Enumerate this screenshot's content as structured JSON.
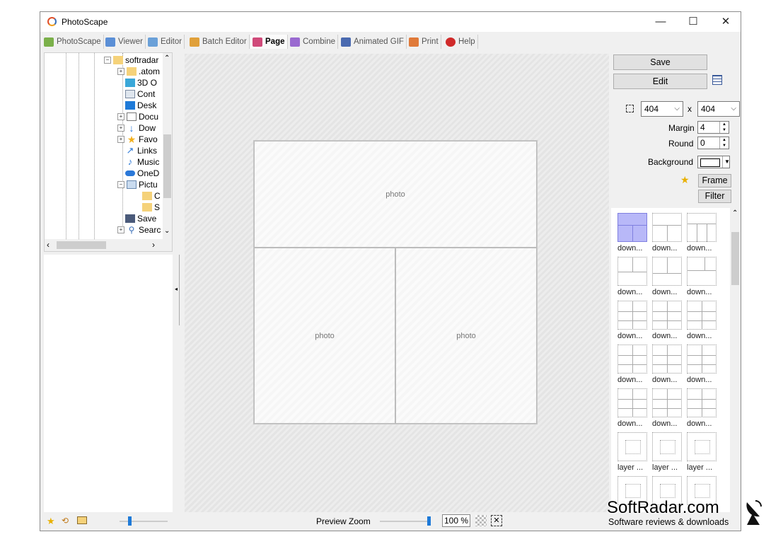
{
  "window": {
    "title": "PhotoScape",
    "minimize": "—",
    "maximize": "☐",
    "close": "✕"
  },
  "tabs": [
    {
      "label": "PhotoScape",
      "color": "#7bb04a",
      "icon": "photoscape-icon"
    },
    {
      "label": "Viewer",
      "color": "#5b8fd6",
      "icon": "viewer-icon"
    },
    {
      "label": "Editor",
      "color": "#6aa0d8",
      "icon": "editor-icon"
    },
    {
      "label": "Batch Editor",
      "color": "#e0a03a",
      "icon": "batch-editor-icon"
    },
    {
      "label": "Page",
      "color": "#d04a7a",
      "icon": "page-icon"
    },
    {
      "label": "Combine",
      "color": "#9a6ad0",
      "icon": "combine-icon"
    },
    {
      "label": "Animated GIF",
      "color": "#4a6ab0",
      "icon": "animated-gif-icon"
    },
    {
      "label": "Print",
      "color": "#e07a3a",
      "icon": "print-icon"
    },
    {
      "label": "Help",
      "color": "#d02a2a",
      "icon": "help-icon"
    }
  ],
  "tree": {
    "root": "softradar",
    "items": [
      {
        "label": ".atom",
        "icon": "folder",
        "expander": "+"
      },
      {
        "label": "3D O",
        "icon": "3d-objects",
        "expander": ""
      },
      {
        "label": "Cont",
        "icon": "contacts",
        "expander": ""
      },
      {
        "label": "Desk",
        "icon": "desktop",
        "expander": ""
      },
      {
        "label": "Docu",
        "icon": "documents",
        "expander": "+"
      },
      {
        "label": "Dow",
        "icon": "downloads",
        "expander": "+"
      },
      {
        "label": "Favo",
        "icon": "favorites",
        "expander": "+"
      },
      {
        "label": "Links",
        "icon": "links",
        "expander": ""
      },
      {
        "label": "Music",
        "icon": "music",
        "expander": ""
      },
      {
        "label": "OneD",
        "icon": "onedrive",
        "expander": ""
      },
      {
        "label": "Pictu",
        "icon": "pictures",
        "expander": "-"
      },
      {
        "label": "C",
        "icon": "folder",
        "expander": "",
        "child": true
      },
      {
        "label": "S",
        "icon": "folder",
        "expander": "",
        "child": true
      },
      {
        "label": "Save",
        "icon": "saved-games",
        "expander": ""
      },
      {
        "label": "Searc",
        "icon": "searches",
        "expander": "+"
      }
    ]
  },
  "canvas": {
    "cells": [
      "photo",
      "photo",
      "photo"
    ]
  },
  "panel": {
    "save": "Save",
    "edit": "Edit",
    "width": "404",
    "x": "x",
    "height": "404",
    "margin_label": "Margin",
    "margin_value": "4",
    "round_label": "Round",
    "round_value": "0",
    "background_label": "Background",
    "frame": "Frame",
    "filter": "Filter"
  },
  "templates": [
    {
      "name": "down...",
      "layout": "one-two",
      "selected": true
    },
    {
      "name": "down...",
      "layout": "one-two",
      "selected": false
    },
    {
      "name": "down...",
      "layout": "three-col",
      "selected": false
    },
    {
      "name": "down...",
      "layout": "top-left",
      "selected": false
    },
    {
      "name": "down...",
      "layout": "mid",
      "selected": false
    },
    {
      "name": "down...",
      "layout": "top-right",
      "selected": false
    },
    {
      "name": "down...",
      "layout": "grid",
      "selected": false
    },
    {
      "name": "down...",
      "layout": "grid",
      "selected": false
    },
    {
      "name": "down...",
      "layout": "grid",
      "selected": false
    },
    {
      "name": "down...",
      "layout": "grid",
      "selected": false
    },
    {
      "name": "down...",
      "layout": "grid",
      "selected": false
    },
    {
      "name": "down...",
      "layout": "grid",
      "selected": false
    },
    {
      "name": "down...",
      "layout": "grid",
      "selected": false
    },
    {
      "name": "down...",
      "layout": "grid",
      "selected": false
    },
    {
      "name": "down...",
      "layout": "grid",
      "selected": false
    },
    {
      "name": "layer ...",
      "layout": "layer",
      "selected": false
    },
    {
      "name": "layer ...",
      "layout": "layer",
      "selected": false
    },
    {
      "name": "layer ...",
      "layout": "layer",
      "selected": false
    },
    {
      "name": "",
      "layout": "layer",
      "selected": false
    },
    {
      "name": "",
      "layout": "layer",
      "selected": false
    },
    {
      "name": "",
      "layout": "layer",
      "selected": false
    }
  ],
  "status": {
    "preview_zoom_label": "Preview Zoom",
    "zoom_value": "100 %",
    "zoom_level": 1.0
  },
  "watermark": {
    "brand": "SoftRadar.com",
    "tagline": "Software reviews & downloads"
  }
}
